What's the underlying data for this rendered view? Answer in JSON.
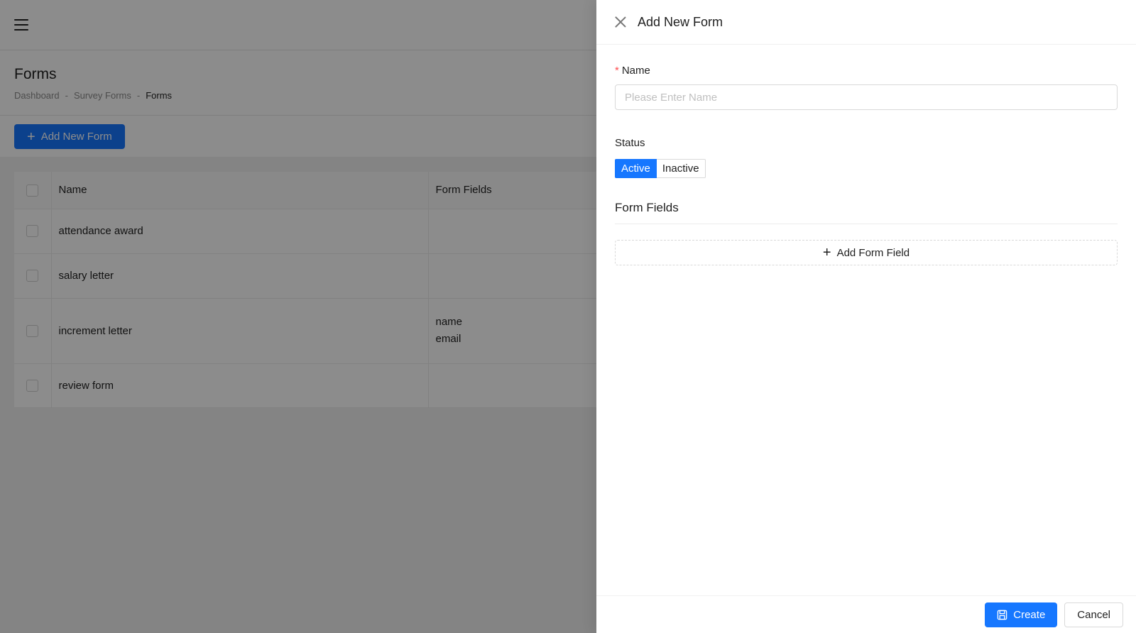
{
  "page": {
    "title": "Forms",
    "breadcrumb": {
      "items": [
        "Dashboard",
        "Survey Forms",
        "Forms"
      ],
      "separator": "-"
    },
    "add_button": "Add New Form",
    "table": {
      "headers": {
        "name": "Name",
        "form_fields": "Form Fields"
      },
      "rows": [
        {
          "name": "attendance award",
          "fields": []
        },
        {
          "name": "salary letter",
          "fields": []
        },
        {
          "name": "increment letter",
          "fields": [
            "name",
            "email"
          ]
        },
        {
          "name": "review form",
          "fields": []
        }
      ]
    }
  },
  "drawer": {
    "title": "Add New Form",
    "name_field": {
      "required_mark": "*",
      "label": "Name",
      "value": "",
      "placeholder": "Please Enter Name"
    },
    "status": {
      "label": "Status",
      "options": [
        "Active",
        "Inactive"
      ],
      "selected": "Active"
    },
    "form_fields": {
      "title": "Form Fields",
      "add_button": "Add Form Field"
    },
    "footer": {
      "create": "Create",
      "cancel": "Cancel"
    }
  },
  "colors": {
    "primary": "#1677ff",
    "required": "#ff4d4f",
    "overlay": "rgba(0,0,0,0.45)"
  }
}
